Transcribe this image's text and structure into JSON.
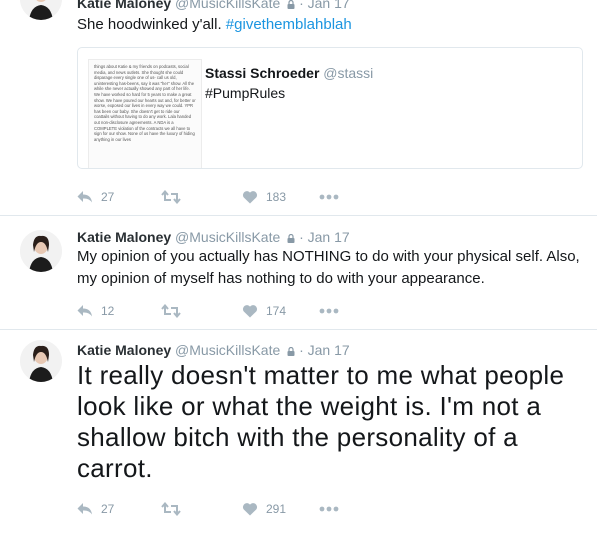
{
  "tweets": [
    {
      "name": "Katie Maloney",
      "handle": "@MusicKillsKate",
      "dot": "·",
      "time": "Jan 17",
      "text_parts": {
        "plain": "She hoodwinked y'all. ",
        "hashtag": "#givethemblahblah"
      },
      "quote": {
        "name": "Stassi Schroeder",
        "handle": "@stassi",
        "text": "#PumpRules",
        "image_text": "things about Katie & my friends on podcasts, social media, and news outlets. She thought she could disparage every single one of us- call us old, uninteresting has-beens, say it was \"her\" show. All the while she never actually showed any part of her life. We have worked so hard for 5 years to make a great show. We have poured our hearts out and, for better or worse, exposed our lives in every way we could. YPR has been our baby. She doesn't get to ride our coattails without having to do any work. Lala handed out non-disclosure agreements. A NDA is a COMPLETE violation of the contracts we all have to sign for our show. None of us have the luxury of hiding anything in our lives"
      },
      "actions": {
        "reply_count": "27",
        "retweet_count": "",
        "like_count": "183"
      }
    },
    {
      "name": "Katie Maloney",
      "handle": "@MusicKillsKate",
      "dot": "·",
      "time": "Jan 17",
      "text": "My opinion of you actually has NOTHING to do with your physical self. Also, my opinion of myself has nothing to do with your appearance.",
      "actions": {
        "reply_count": "12",
        "retweet_count": "",
        "like_count": "174"
      }
    },
    {
      "name": "Katie Maloney",
      "handle": "@MusicKillsKate",
      "dot": "·",
      "time": "Jan 17",
      "text": "It really doesn't matter to me what people look like or what the weight is. I'm not a shallow bitch with the personality of a carrot.",
      "actions": {
        "reply_count": "27",
        "retweet_count": "",
        "like_count": "291"
      }
    }
  ],
  "icons": {
    "reply": "reply-icon",
    "retweet": "retweet-icon",
    "like": "heart-icon",
    "more": "more-icon",
    "lock": "lock-icon"
  },
  "colors": {
    "link": "#1b95e0",
    "muted": "#8899a6",
    "icon": "#aab8c2",
    "divider": "#e1e8ed"
  }
}
